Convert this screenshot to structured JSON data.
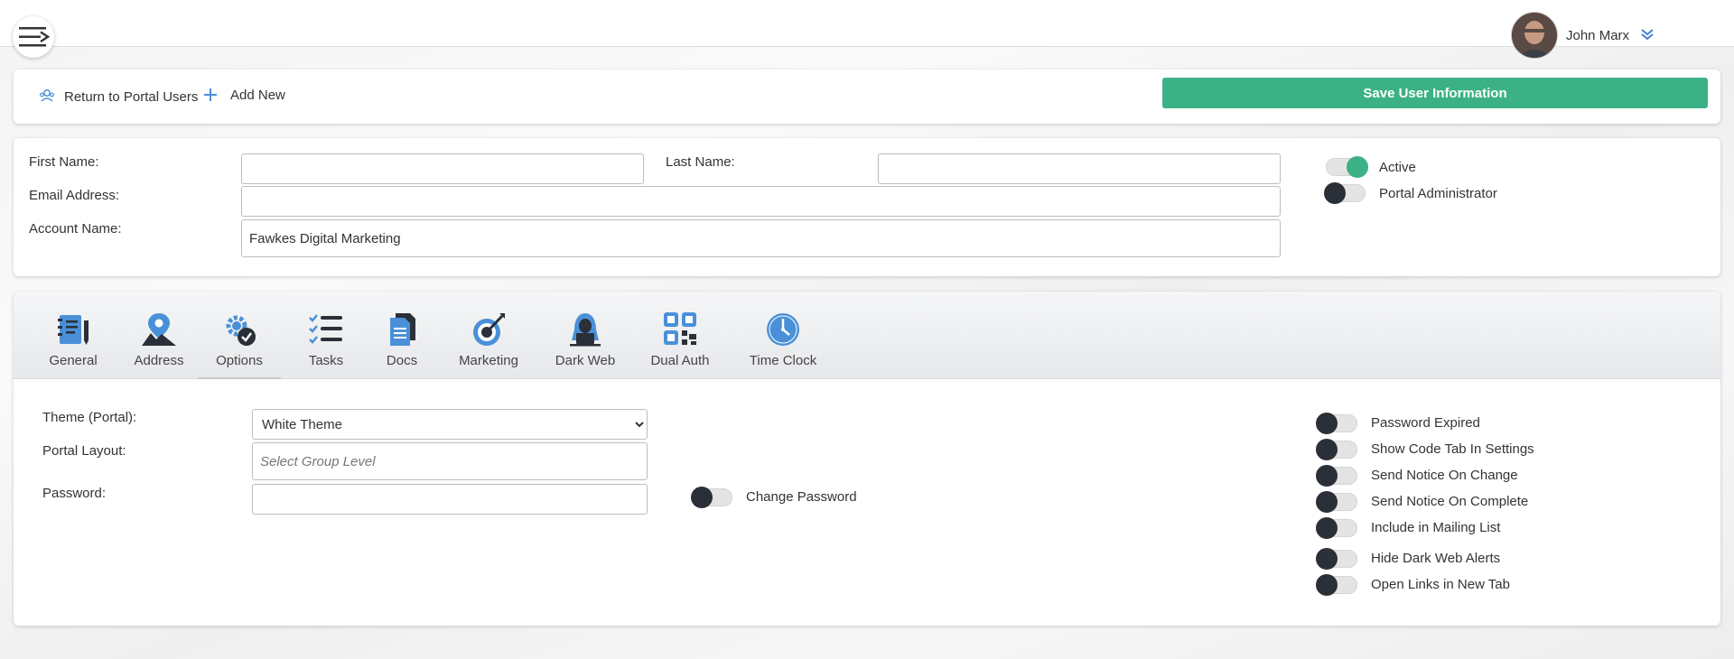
{
  "user": {
    "name": "John Marx"
  },
  "toolbar": {
    "return_label": "Return to Portal Users",
    "add_new_label": "Add New",
    "save_label": "Save User Information"
  },
  "user_form": {
    "first_name_label": "First Name:",
    "first_name_value": "",
    "last_name_label": "Last Name:",
    "last_name_value": "",
    "email_label": "Email Address:",
    "email_value": "",
    "account_label": "Account Name:",
    "account_value": "Fawkes Digital Marketing",
    "toggles": [
      {
        "label": "Active",
        "on": true
      },
      {
        "label": "Portal Administrator",
        "on": false
      }
    ]
  },
  "tabs": [
    {
      "label": "General",
      "icon": "notebook-icon"
    },
    {
      "label": "Address",
      "icon": "map-pin-icon"
    },
    {
      "label": "Options",
      "icon": "gear-check-icon",
      "active": true
    },
    {
      "label": "Tasks",
      "icon": "checklist-icon"
    },
    {
      "label": "Docs",
      "icon": "documents-icon"
    },
    {
      "label": "Marketing",
      "icon": "target-icon"
    },
    {
      "label": "Dark Web",
      "icon": "hacker-icon"
    },
    {
      "label": "Dual Auth",
      "icon": "qr-code-icon"
    },
    {
      "label": "Time Clock",
      "icon": "clock-icon"
    }
  ],
  "options": {
    "theme_label": "Theme (Portal):",
    "theme_selected": "White Theme",
    "layout_label": "Portal Layout:",
    "layout_placeholder": "Select Group Level",
    "password_label": "Password:",
    "password_value": "",
    "change_password_label": "Change Password",
    "toggles": [
      {
        "label": "Password Expired",
        "on": false
      },
      {
        "label": "Show Code Tab In Settings",
        "on": false
      },
      {
        "label": "Send Notice On Change",
        "on": false
      },
      {
        "label": "Send Notice On Complete",
        "on": false
      },
      {
        "label": "Include in Mailing List",
        "on": false
      },
      {
        "label": "Hide Dark Web Alerts",
        "on": false
      },
      {
        "label": "Open Links in New Tab",
        "on": false
      }
    ]
  },
  "colors": {
    "accent": "#3db186",
    "icon_blue": "#4a90d9",
    "icon_dark": "#2b2f38"
  }
}
